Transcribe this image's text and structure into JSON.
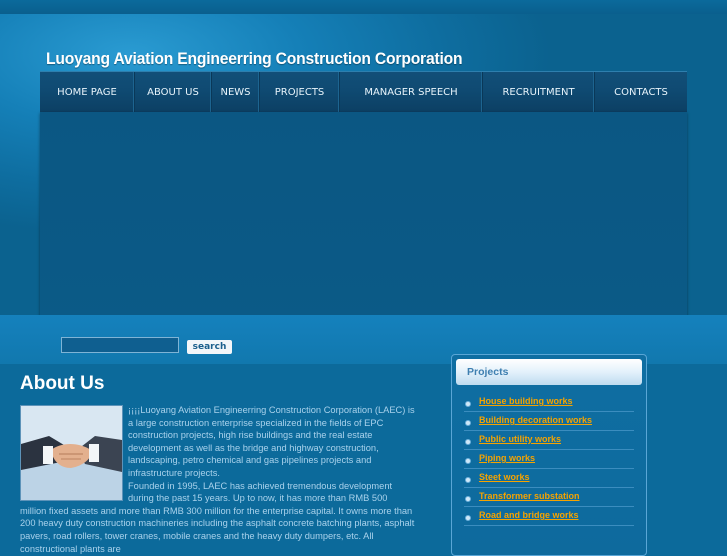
{
  "site": {
    "title": "Luoyang Aviation Engineerring Construction Corporation"
  },
  "nav": [
    {
      "label": "HOME PAGE"
    },
    {
      "label": "ABOUT US"
    },
    {
      "label": "NEWS"
    },
    {
      "label": "PROJECTS"
    },
    {
      "label": "MANAGER SPEECH"
    },
    {
      "label": "RECRUITMENT"
    },
    {
      "label": "CONTACTS"
    }
  ],
  "search": {
    "button_label": "search",
    "value": "",
    "placeholder": ""
  },
  "about": {
    "title": "About Us",
    "paragraph1": "¡¡¡¡Luoyang Aviation Engineerring Construction Corporation (LAEC) is a large construction enterprise specialized in the fields of EPC construction projects, high rise buildings and the real estate development as well as the bridge and highway construction, landscaping, petro chemical and gas pipelines projects and infrastructure projects.",
    "paragraph2": "Founded in 1995, LAEC has achieved tremendous development during the past 15 years. Up to now, it has more than RMB 500 million fixed assets and more than RMB 300 million for the enterprise capital. It owns more than 200 heavy duty construction machineries including the asphalt concrete batching plants, asphalt pavers, road rollers, tower cranes, mobile cranes and the heavy duty dumpers, etc. All constructional plants are"
  },
  "projects": {
    "title": "Projects",
    "items": [
      {
        "label": "House building works"
      },
      {
        "label": "Building decoration works"
      },
      {
        "label": "Public utility works"
      },
      {
        "label": "Piping works"
      },
      {
        "label": "Steet works"
      },
      {
        "label": "Transformer substation"
      },
      {
        "label": "Road and bridge works"
      }
    ]
  },
  "colors": {
    "background": "#0c6a9b",
    "nav_bar": "#0f4a72",
    "link_orange": "#f5a300",
    "body_text": "#a9d2ec"
  }
}
